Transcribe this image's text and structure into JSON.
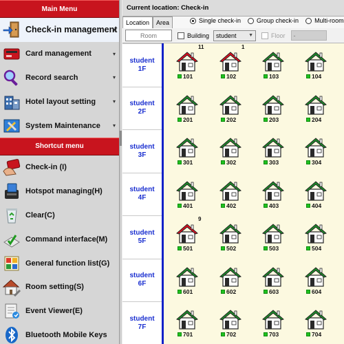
{
  "sidebar": {
    "main_menu_title": "Main Menu",
    "main_items": [
      {
        "label": "Check-in management",
        "icon": "door-exit-icon",
        "active": true
      },
      {
        "label": "Card management",
        "icon": "card-icon",
        "active": false
      },
      {
        "label": "Record search",
        "icon": "magnifier-icon",
        "active": false
      },
      {
        "label": "Hotel layout setting",
        "icon": "building-icon",
        "active": false
      },
      {
        "label": "System Maintenance",
        "icon": "tools-icon",
        "active": false
      }
    ],
    "shortcut_title": "Shortcut menu",
    "shortcut_items": [
      {
        "label": "Check-in (I)",
        "icon": "checkin-card-icon"
      },
      {
        "label": "Hotspot managing(H)",
        "icon": "card-reader-icon"
      },
      {
        "label": "Clear(C)",
        "icon": "recycle-bin-icon"
      },
      {
        "label": "Command interface(M)",
        "icon": "command-interface-icon"
      },
      {
        "label": "General function list(G)",
        "icon": "function-list-icon"
      },
      {
        "label": "Room setting(S)",
        "icon": "house-wrench-icon"
      },
      {
        "label": "Event Viewer(E)",
        "icon": "event-viewer-icon"
      },
      {
        "label": "Bluetooth Mobile Keys",
        "icon": "bluetooth-icon"
      }
    ]
  },
  "location_bar": "Current location:  Check-in",
  "tabs": [
    {
      "label": "Location",
      "active": true
    },
    {
      "label": "Area",
      "active": false
    }
  ],
  "checkin_modes": [
    {
      "label": "Single check-in",
      "checked": true
    },
    {
      "label": "Group check-in",
      "checked": false
    },
    {
      "label": "Multi-room",
      "checked": false
    }
  ],
  "filters": {
    "room_placeholder": "Room",
    "building_label": "Building",
    "building_select": "student",
    "floor_label": "Floor",
    "floor_select": "-"
  },
  "floors": [
    {
      "name": "student",
      "level": "1F",
      "rooms": [
        {
          "number": "101",
          "occupied": true,
          "count": "11"
        },
        {
          "number": "102",
          "occupied": true,
          "count": "1"
        },
        {
          "number": "103",
          "occupied": false,
          "count": ""
        },
        {
          "number": "104",
          "occupied": false,
          "count": ""
        }
      ]
    },
    {
      "name": "student",
      "level": "2F",
      "rooms": [
        {
          "number": "201",
          "occupied": false,
          "count": ""
        },
        {
          "number": "202",
          "occupied": false,
          "count": ""
        },
        {
          "number": "203",
          "occupied": false,
          "count": ""
        },
        {
          "number": "204",
          "occupied": false,
          "count": ""
        }
      ]
    },
    {
      "name": "student",
      "level": "3F",
      "rooms": [
        {
          "number": "301",
          "occupied": false,
          "count": ""
        },
        {
          "number": "302",
          "occupied": false,
          "count": ""
        },
        {
          "number": "303",
          "occupied": false,
          "count": ""
        },
        {
          "number": "304",
          "occupied": false,
          "count": ""
        }
      ]
    },
    {
      "name": "student",
      "level": "4F",
      "rooms": [
        {
          "number": "401",
          "occupied": false,
          "count": ""
        },
        {
          "number": "402",
          "occupied": false,
          "count": ""
        },
        {
          "number": "403",
          "occupied": false,
          "count": ""
        },
        {
          "number": "404",
          "occupied": false,
          "count": ""
        }
      ]
    },
    {
      "name": "student",
      "level": "5F",
      "rooms": [
        {
          "number": "501",
          "occupied": true,
          "count": "9"
        },
        {
          "number": "502",
          "occupied": false,
          "count": ""
        },
        {
          "number": "503",
          "occupied": false,
          "count": ""
        },
        {
          "number": "504",
          "occupied": false,
          "count": ""
        }
      ]
    },
    {
      "name": "student",
      "level": "6F",
      "rooms": [
        {
          "number": "601",
          "occupied": false,
          "count": ""
        },
        {
          "number": "602",
          "occupied": false,
          "count": ""
        },
        {
          "number": "603",
          "occupied": false,
          "count": ""
        },
        {
          "number": "604",
          "occupied": false,
          "count": ""
        }
      ]
    },
    {
      "name": "student",
      "level": "7F",
      "rooms": [
        {
          "number": "701",
          "occupied": false,
          "count": ""
        },
        {
          "number": "702",
          "occupied": false,
          "count": ""
        },
        {
          "number": "703",
          "occupied": false,
          "count": ""
        },
        {
          "number": "704",
          "occupied": false,
          "count": ""
        }
      ]
    }
  ],
  "colors": {
    "header_red": "#c8141e",
    "floor_text_blue": "#1a2fd0",
    "roof_occupied": "#e01020",
    "roof_vacant": "#1e8c2a",
    "status_green": "#1fc21f",
    "grid_background": "#fcf9e0"
  }
}
